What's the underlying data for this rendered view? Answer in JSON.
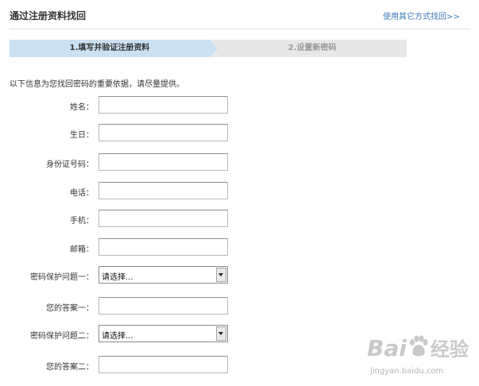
{
  "header": {
    "title": "通过注册资料找回",
    "link": "使用其它方式找回>>"
  },
  "steps": [
    {
      "label": "1.填写并验证注册资料",
      "active": true
    },
    {
      "label": "2.设置新密码",
      "active": false
    }
  ],
  "intro": "以下信息为您找回密码的重要依据，请尽量提供。",
  "form": {
    "fields": [
      {
        "label": "姓名：",
        "type": "text",
        "value": ""
      },
      {
        "label": "生日：",
        "type": "text",
        "value": ""
      },
      {
        "label": "身份证号码：",
        "type": "text",
        "value": ""
      },
      {
        "label": "电话：",
        "type": "text",
        "value": ""
      },
      {
        "label": "手机：",
        "type": "text",
        "value": ""
      },
      {
        "label": "邮箱：",
        "type": "text",
        "value": ""
      },
      {
        "label": "密码保护问题一：",
        "type": "select",
        "value": "请选择..."
      },
      {
        "label": "您的答案一：",
        "type": "text",
        "value": ""
      },
      {
        "label": "密码保护问题二：",
        "type": "select",
        "value": "请选择..."
      },
      {
        "label": "您的答案二：",
        "type": "text",
        "value": ""
      }
    ]
  },
  "watermark": {
    "brand_left": "Bai",
    "brand_right": "经验",
    "url": "jingyan.baidu.com",
    "icon": "paw-icon"
  },
  "colors": {
    "link": "#3a78b8",
    "active_step": "#cbe0f1",
    "inactive_step": "#e8e8e8"
  }
}
